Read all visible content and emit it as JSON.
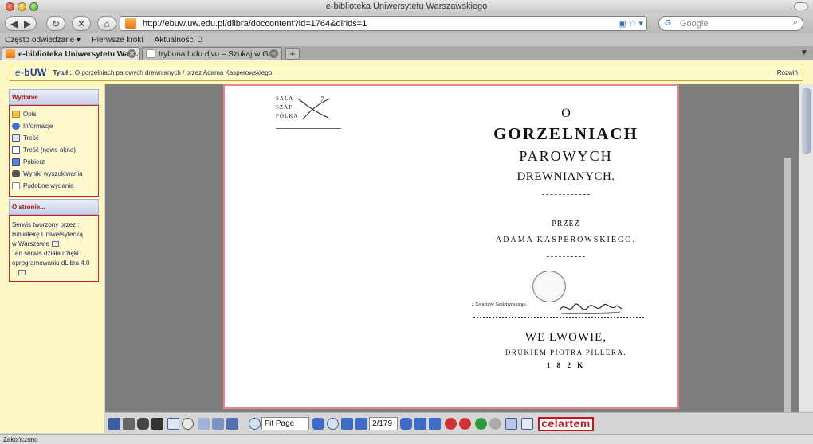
{
  "window": {
    "title": "e-biblioteka Uniwersytetu Warszawskiego"
  },
  "navbar": {
    "url": "http://ebuw.uw.edu.pl/dlibra/doccontent?id=1764&dirids=1",
    "search_placeholder": "Google"
  },
  "bookmarks": [
    "Często odwiedzane ▾",
    "Pierwsze kroki",
    "Aktualności ℑ"
  ],
  "tabs": [
    {
      "label": "e-biblioteka Uniwersytetu Wars..."
    },
    {
      "label": "trybuna ludu djvu – Szukaj w G..."
    }
  ],
  "docbar": {
    "logo_prefix": "e-",
    "logo_main": "bUW",
    "title_label": "Tytuł :",
    "title": "O gorzelniach parowych drewnianych / przez Adama Kasperowskiego.",
    "expand_label": "Rozwiń"
  },
  "sidebar": {
    "edition_heading": "Wydanie",
    "edition_items": [
      "Opis",
      "Informacje",
      "Treść",
      "Treść (nowe okno)",
      "Pobierz",
      "Wyniki wyszukiwania",
      "Podobne wydania"
    ],
    "about_heading": "O stronie...",
    "about_line1": "Serwis tworzony przez :",
    "about_line2": "Bibliotekę Uniwersytecką",
    "about_line3": "w Warszawie",
    "about_line4": "Ten serwis działa dzięki",
    "about_line5": "oprogramowaniu dLibra 4.0"
  },
  "page": {
    "stamp_lines": [
      "SALA",
      "SZAF",
      "PÓŁKA"
    ],
    "stamp_pencil": "7",
    "line_o": "O",
    "line_gorzelniach": "GORZELNIACH",
    "line_parowych": "PAROWYCH",
    "line_drewnianych": "DREWNIANYCH.",
    "line_przez": "PRZEZ",
    "line_author": "ADAMA KASPEROWSKIEGO.",
    "line_ex": "z Xsiężnów Sapiehyńskiego.",
    "line_place": "WE LWOWIE,",
    "line_printer": "DRUKIEM PIOTRA PILLERA.",
    "line_year": "1 8 2 K"
  },
  "viewer_toolbar": {
    "zoom_value": "Fit Page",
    "page_value": "2/179",
    "brand": "celartem"
  },
  "status": {
    "text": "Zakończono"
  }
}
